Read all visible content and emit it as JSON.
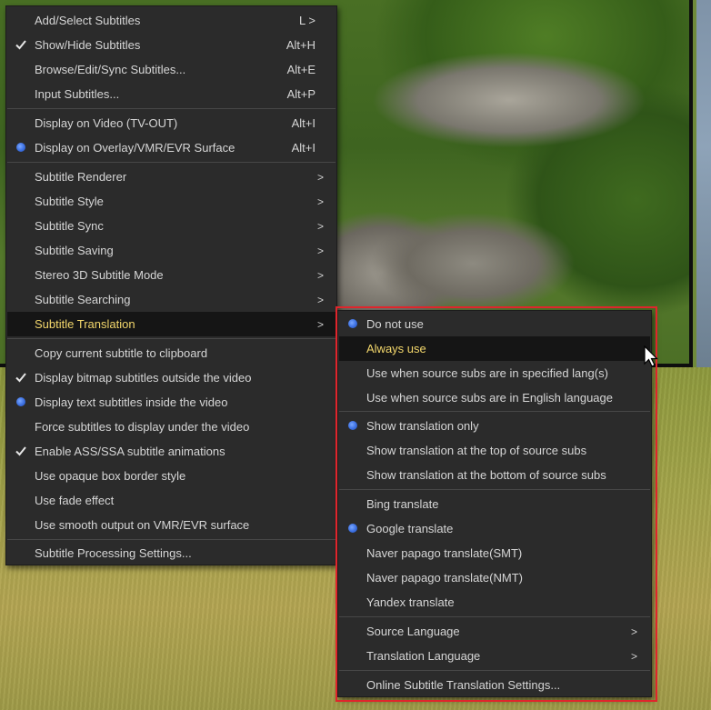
{
  "main_menu": {
    "items": [
      {
        "label": "Add/Select Subtitles",
        "shortcut": "L >",
        "mark": ""
      },
      {
        "label": "Show/Hide Subtitles",
        "shortcut": "Alt+H",
        "mark": "check"
      },
      {
        "label": "Browse/Edit/Sync Subtitles...",
        "shortcut": "Alt+E",
        "mark": ""
      },
      {
        "label": "Input Subtitles...",
        "shortcut": "Alt+P",
        "mark": ""
      },
      {
        "label": "Display on Video (TV-OUT)",
        "shortcut": "Alt+I",
        "mark": ""
      },
      {
        "label": "Display on Overlay/VMR/EVR Surface",
        "shortcut": "Alt+I",
        "mark": "radio"
      },
      {
        "label": "Subtitle Renderer",
        "shortcut": ">",
        "mark": ""
      },
      {
        "label": "Subtitle Style",
        "shortcut": ">",
        "mark": ""
      },
      {
        "label": "Subtitle Sync",
        "shortcut": ">",
        "mark": ""
      },
      {
        "label": "Subtitle Saving",
        "shortcut": ">",
        "mark": ""
      },
      {
        "label": "Stereo 3D Subtitle Mode",
        "shortcut": ">",
        "mark": ""
      },
      {
        "label": "Subtitle Searching",
        "shortcut": ">",
        "mark": ""
      },
      {
        "label": "Subtitle Translation",
        "shortcut": ">",
        "mark": ""
      },
      {
        "label": "Copy current subtitle to clipboard",
        "shortcut": "",
        "mark": ""
      },
      {
        "label": "Display bitmap subtitles outside the video",
        "shortcut": "",
        "mark": "check"
      },
      {
        "label": "Display text subtitles inside the video",
        "shortcut": "",
        "mark": "radio"
      },
      {
        "label": "Force subtitles to display under the video",
        "shortcut": "",
        "mark": ""
      },
      {
        "label": "Enable ASS/SSA subtitle animations",
        "shortcut": "",
        "mark": "check"
      },
      {
        "label": "Use opaque box border style",
        "shortcut": "",
        "mark": ""
      },
      {
        "label": "Use fade effect",
        "shortcut": "",
        "mark": ""
      },
      {
        "label": "Use smooth output on VMR/EVR surface",
        "shortcut": "",
        "mark": ""
      },
      {
        "label": "Subtitle Processing Settings...",
        "shortcut": "",
        "mark": ""
      }
    ]
  },
  "translation_submenu": {
    "items": [
      {
        "label": "Do not use",
        "mark": "radio",
        "arrow": ""
      },
      {
        "label": "Always use",
        "mark": "",
        "arrow": ""
      },
      {
        "label": "Use when source subs are in specified lang(s)",
        "mark": "",
        "arrow": ""
      },
      {
        "label": "Use when source subs are in English language",
        "mark": "",
        "arrow": ""
      },
      {
        "label": "Show translation only",
        "mark": "radio",
        "arrow": ""
      },
      {
        "label": "Show translation at the top of source subs",
        "mark": "",
        "arrow": ""
      },
      {
        "label": "Show translation at the bottom of source subs",
        "mark": "",
        "arrow": ""
      },
      {
        "label": "Bing translate",
        "mark": "",
        "arrow": ""
      },
      {
        "label": "Google translate",
        "mark": "radio",
        "arrow": ""
      },
      {
        "label": "Naver papago translate(SMT)",
        "mark": "",
        "arrow": ""
      },
      {
        "label": "Naver papago translate(NMT)",
        "mark": "",
        "arrow": ""
      },
      {
        "label": "Yandex translate",
        "mark": "",
        "arrow": ""
      },
      {
        "label": "Source Language",
        "mark": "",
        "arrow": ">"
      },
      {
        "label": "Translation Language",
        "mark": "",
        "arrow": ">"
      },
      {
        "label": "Online Subtitle Translation Settings...",
        "mark": "",
        "arrow": ""
      }
    ]
  },
  "colors": {
    "menu_bg": "#2b2b2b",
    "hover_bg": "#151515",
    "hover_text": "#f2d66b",
    "radio": "#3b6fe0",
    "highlight_frame": "#e0252c"
  }
}
